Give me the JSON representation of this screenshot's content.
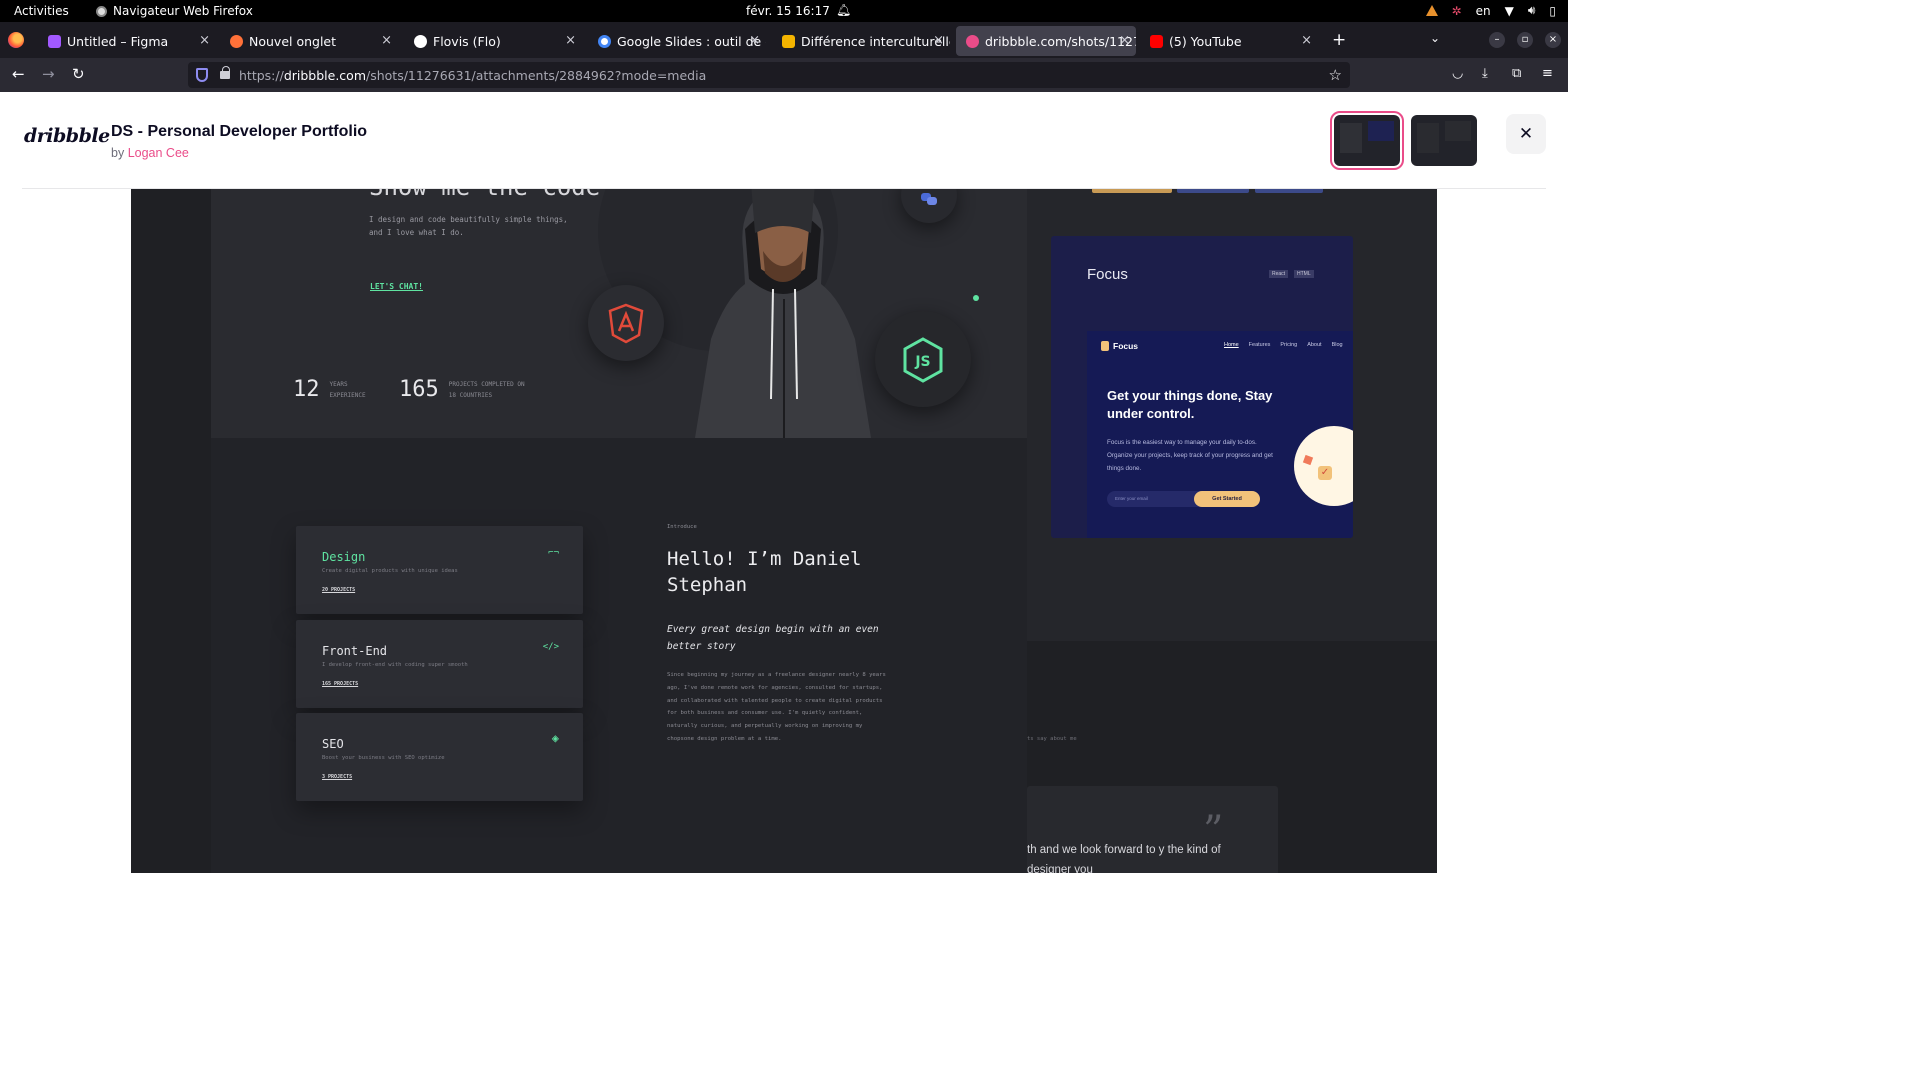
{
  "system": {
    "activities": "Activities",
    "app_name": "Navigateur Web Firefox",
    "clock": "févr. 15  16:17",
    "language": "en"
  },
  "tabs": [
    {
      "title": "Untitled – Figma",
      "favicon_color": "#a259ff"
    },
    {
      "title": "Nouvel onglet",
      "favicon_color": "#ff7139"
    },
    {
      "title": "Flovis (Flo)",
      "favicon_color": "#ffffff"
    },
    {
      "title": "Google Slides : outil de cr",
      "favicon_color": "#4285f4"
    },
    {
      "title": "Différence interculturelle",
      "favicon_color": "#f4b400"
    },
    {
      "title": "dribbble.com/shots/1127",
      "favicon_color": "#ea4c89",
      "active": true
    },
    {
      "title": "(5) YouTube",
      "favicon_color": "#ff0000"
    }
  ],
  "urlbar": {
    "prefix": "https://",
    "domain": "dribbble.com",
    "path": "/shots/11276631/attachments/2884962?mode=media"
  },
  "dribbble": {
    "logo": "dribbble",
    "shot_title": "DS - Personal Developer Portfolio",
    "by": "by",
    "author": "Logan Cee",
    "accent": "#ea4c89"
  },
  "hero": {
    "headline": "Show me the code",
    "tagline": "I design and code beautifully simple things, and I love what I do.",
    "cta": "LET'S CHAT!",
    "stats": [
      {
        "num": "12",
        "label": "YEARS EXPERIENCE"
      },
      {
        "num": "165",
        "label": "PROJECTS COMPLETED ON 18 COUNTRIES"
      }
    ]
  },
  "services": [
    {
      "title": "Design",
      "desc": "Create digital products with unique ideas",
      "count": "20 PROJECTS",
      "icon": "pen-tool-icon",
      "glyph": "⌐¬"
    },
    {
      "title": "Front-End",
      "desc": "I develop front-end with coding super smooth",
      "count": "165 PROJECTS",
      "icon": "code-icon",
      "glyph": "</>"
    },
    {
      "title": "SEO",
      "desc": "Boost your business with SEO optimize",
      "count": "3 PROJECTS",
      "icon": "target-icon",
      "glyph": "◈"
    }
  ],
  "intro": {
    "eyebrow": "Introduce",
    "title": "Hello! I’m Daniel Stephan",
    "quote": "Every great design begin with an even better story",
    "body": "Since beginning my journey as a freelance designer nearly 8 years ago, I've done remote work for agencies, consulted for startups, and collaborated with talented people to create digital products for both business and consumer use. I'm quietly confident, naturally curious, and perpetually working on improving my chopsone design problem at a time."
  },
  "focus_card": {
    "title": "Focus",
    "tags": [
      "React",
      "HTML"
    ],
    "app_brand": "Focus",
    "menu": [
      "Home",
      "Features",
      "Pricing",
      "About",
      "Blog"
    ],
    "headline": "Get your things done, Stay under control.",
    "sub": "Focus is the easiest way to manage your daily to-dos. Organize your projects, keep track of your progress and get things done.",
    "email_placeholder": "Enter your email",
    "cta": "Get Started"
  },
  "testimonials": {
    "partial_label": "ts say about me",
    "partial_quote": "th and we look forward to y the kind of designer you"
  }
}
